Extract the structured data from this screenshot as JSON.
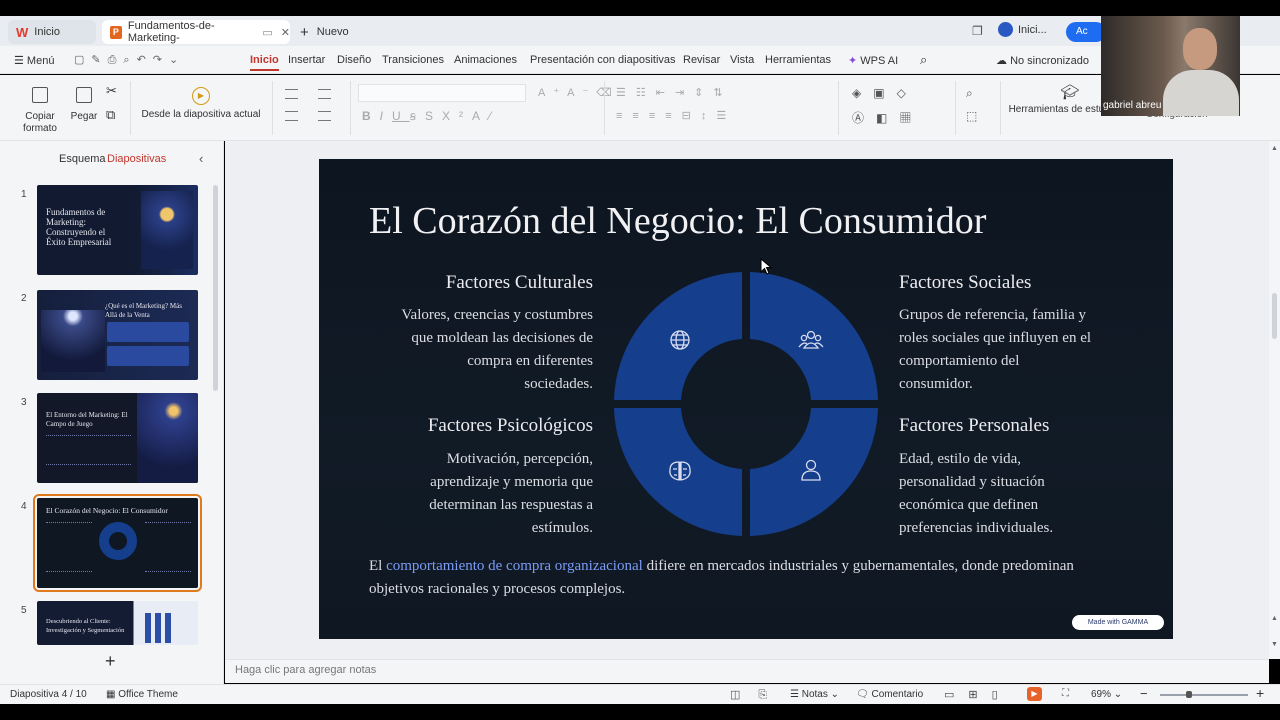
{
  "tabs": {
    "home": "Inicio",
    "doc": "Fundamentos-de-Marketing-",
    "new": "Nuevo"
  },
  "login": "Inici...",
  "acc_button": "Ac",
  "menu": {
    "main": "Menú",
    "items": [
      "Inicio",
      "Insertar",
      "Diseño",
      "Transiciones",
      "Animaciones",
      "Presentación con diapositivas",
      "Revisar",
      "Vista",
      "Herramientas",
      "WPS AI"
    ],
    "sync": "No sincronizado"
  },
  "ribbon": {
    "copy_format": "Copiar formato",
    "paste": "Pegar",
    "from_slide": "Desde la diapositiva actual",
    "student_tools": "Herramientas de estudiante",
    "config": "Configuración"
  },
  "panel": {
    "outline": "Esquema",
    "slides": "Diapositivas"
  },
  "thumbs": [
    {
      "num": "1",
      "title": "Fundamentos de Marketing: Construyendo el Éxito Empresarial"
    },
    {
      "num": "2",
      "title": "¿Qué es el Marketing? Más Allá de la Venta"
    },
    {
      "num": "3",
      "title": "El Entorno del Marketing: El Campo de Juego"
    },
    {
      "num": "4",
      "title": "El Corazón del Negocio: El Consumidor"
    },
    {
      "num": "5",
      "title": "Descubriendo al Cliente: Investigación y Segmentación"
    }
  ],
  "slide": {
    "title": "El Corazón del Negocio: El Consumidor",
    "cultural_h": "Factores Culturales",
    "cultural_p": [
      "Valores, creencias y costumbres",
      "que moldean las decisiones de",
      "compra en diferentes",
      "sociedades."
    ],
    "social_h": "Factores Sociales",
    "social_p": [
      "Grupos de referencia, familia y",
      "roles sociales que influyen en el",
      "comportamiento del",
      "consumidor."
    ],
    "psych_h": "Factores Psicológicos",
    "psych_p": [
      "Motivación, percepción,",
      "aprendizaje y memoria que",
      "determinan las respuestas a",
      "estímulos."
    ],
    "personal_h": "Factores Personales",
    "personal_p": [
      "Edad, estilo de vida,",
      "personalidad y situación",
      "económica que definen",
      "preferencias individuales."
    ],
    "footer_pre": "El ",
    "footer_hl": "comportamiento de compra organizacional",
    "footer_post": " difiere en mercados industriales y gubernamentales, donde predominan objetivos racionales y procesos complejos.",
    "badge": "Made with GAMMA"
  },
  "notes_placeholder": "Haga clic para agregar notas",
  "status": {
    "slide": "Diapositiva 4 / 10",
    "theme": "Office Theme",
    "notes": "Notas",
    "comment": "Comentario",
    "zoom": "69%"
  },
  "webcam_name": "gabriel abreu",
  "colors": {
    "accent": "#c0372e",
    "slide_bg": "#0f1722",
    "ring_blue": "#153e8c",
    "link_blue": "#7b9cf5",
    "selection": "#e07a1f"
  }
}
